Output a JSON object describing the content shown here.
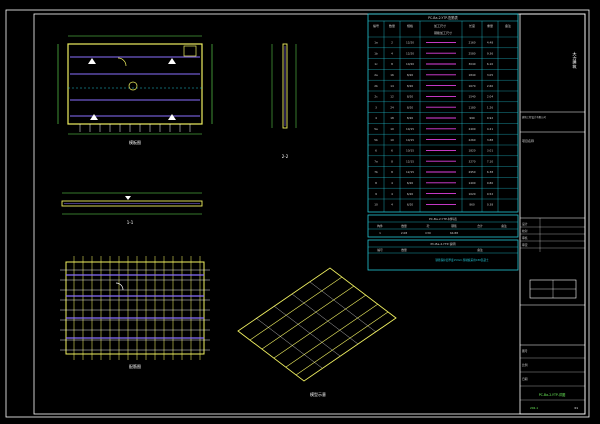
{
  "colors": {
    "background": "#000000",
    "frame": "#ffffff",
    "line_cyan": "#22c8d8",
    "line_green": "#6cf05a",
    "line_yellow": "#f0f060",
    "line_magenta": "#e040e0",
    "line_purple": "#8a70ff",
    "table_text": "#d0d0d0",
    "accent_red": "#ff3060"
  },
  "drawings": {
    "plan_label": "模板图",
    "section_label": "1-1",
    "rebar_label": "配筋图",
    "side_label": "2-2",
    "iso_label": "模型示意"
  },
  "table": {
    "title": "PC-Ba-2-YTP-配筋表",
    "sub_title": "钢筋加工尺寸",
    "columns": [
      "编号",
      "数量",
      "规格",
      "加工尺寸",
      "长度",
      "重量",
      "备注"
    ],
    "rows": [
      [
        "1a",
        "2",
        "12/20",
        "",
        "2160",
        "4.48",
        ""
      ],
      [
        "1b",
        "4",
        "12/20",
        "",
        "2580",
        "9.36",
        ""
      ],
      [
        "1c",
        "8",
        "10/20",
        "",
        "3040",
        "6.10",
        ""
      ],
      [
        "2a",
        "16",
        "8/20",
        "",
        "1840",
        "3.05",
        ""
      ],
      [
        "2b",
        "14",
        "8/20",
        "",
        "1670",
        "2.60",
        ""
      ],
      [
        "2c",
        "12",
        "8/20",
        "",
        "1540",
        "2.04",
        ""
      ],
      [
        "3",
        "24",
        "8/20",
        "",
        "1180",
        "1.26",
        ""
      ],
      [
        "4",
        "18",
        "8/20",
        "",
        "990",
        "0.92",
        ""
      ],
      [
        "5a",
        "10",
        "10/15",
        "",
        "2400",
        "4.21",
        ""
      ],
      [
        "5b",
        "10",
        "10/15",
        "",
        "2260",
        "3.88",
        ""
      ],
      [
        "6",
        "6",
        "10/15",
        "",
        "1820",
        "3.01",
        ""
      ],
      [
        "7a",
        "8",
        "12/15",
        "",
        "3270",
        "7.10",
        ""
      ],
      [
        "7b",
        "8",
        "12/15",
        "",
        "2950",
        "6.38",
        ""
      ],
      [
        "8",
        "4",
        "6/20",
        "",
        "1400",
        "0.80",
        ""
      ],
      [
        "9",
        "4",
        "6/20",
        "",
        "1020",
        "0.52",
        ""
      ],
      [
        "10",
        "4",
        "6/20",
        "",
        "860",
        "0.38",
        ""
      ]
    ],
    "summary_title": "PC-Ba-2-YTP-材料表",
    "summary_columns": [
      "构件",
      "数量",
      "砼",
      "钢筋",
      "合计",
      "备注"
    ],
    "summary_row": [
      "1",
      "2.08",
      "C30",
      "64.88",
      "",
      ""
    ],
    "note_title": "PC-Ba-2-YTP-说明",
    "note_columns": [
      "编号",
      "数量",
      "备注"
    ],
    "note_text": "钢筋保护层厚度15mm,预制板采用C30混凝土"
  },
  "title_block": {
    "vertical_text": "大力建筑",
    "company_note": "建筑工程设计有限公司",
    "project_label": "项目名称",
    "drawing_title": "PC-Ba-2-YTP-详图",
    "sheet_no": "图号",
    "scale_label": "比例",
    "date_label": "日期",
    "rows": [
      "设计",
      "校对",
      "审核",
      "审定"
    ],
    "code": "202-1",
    "page": "01"
  }
}
